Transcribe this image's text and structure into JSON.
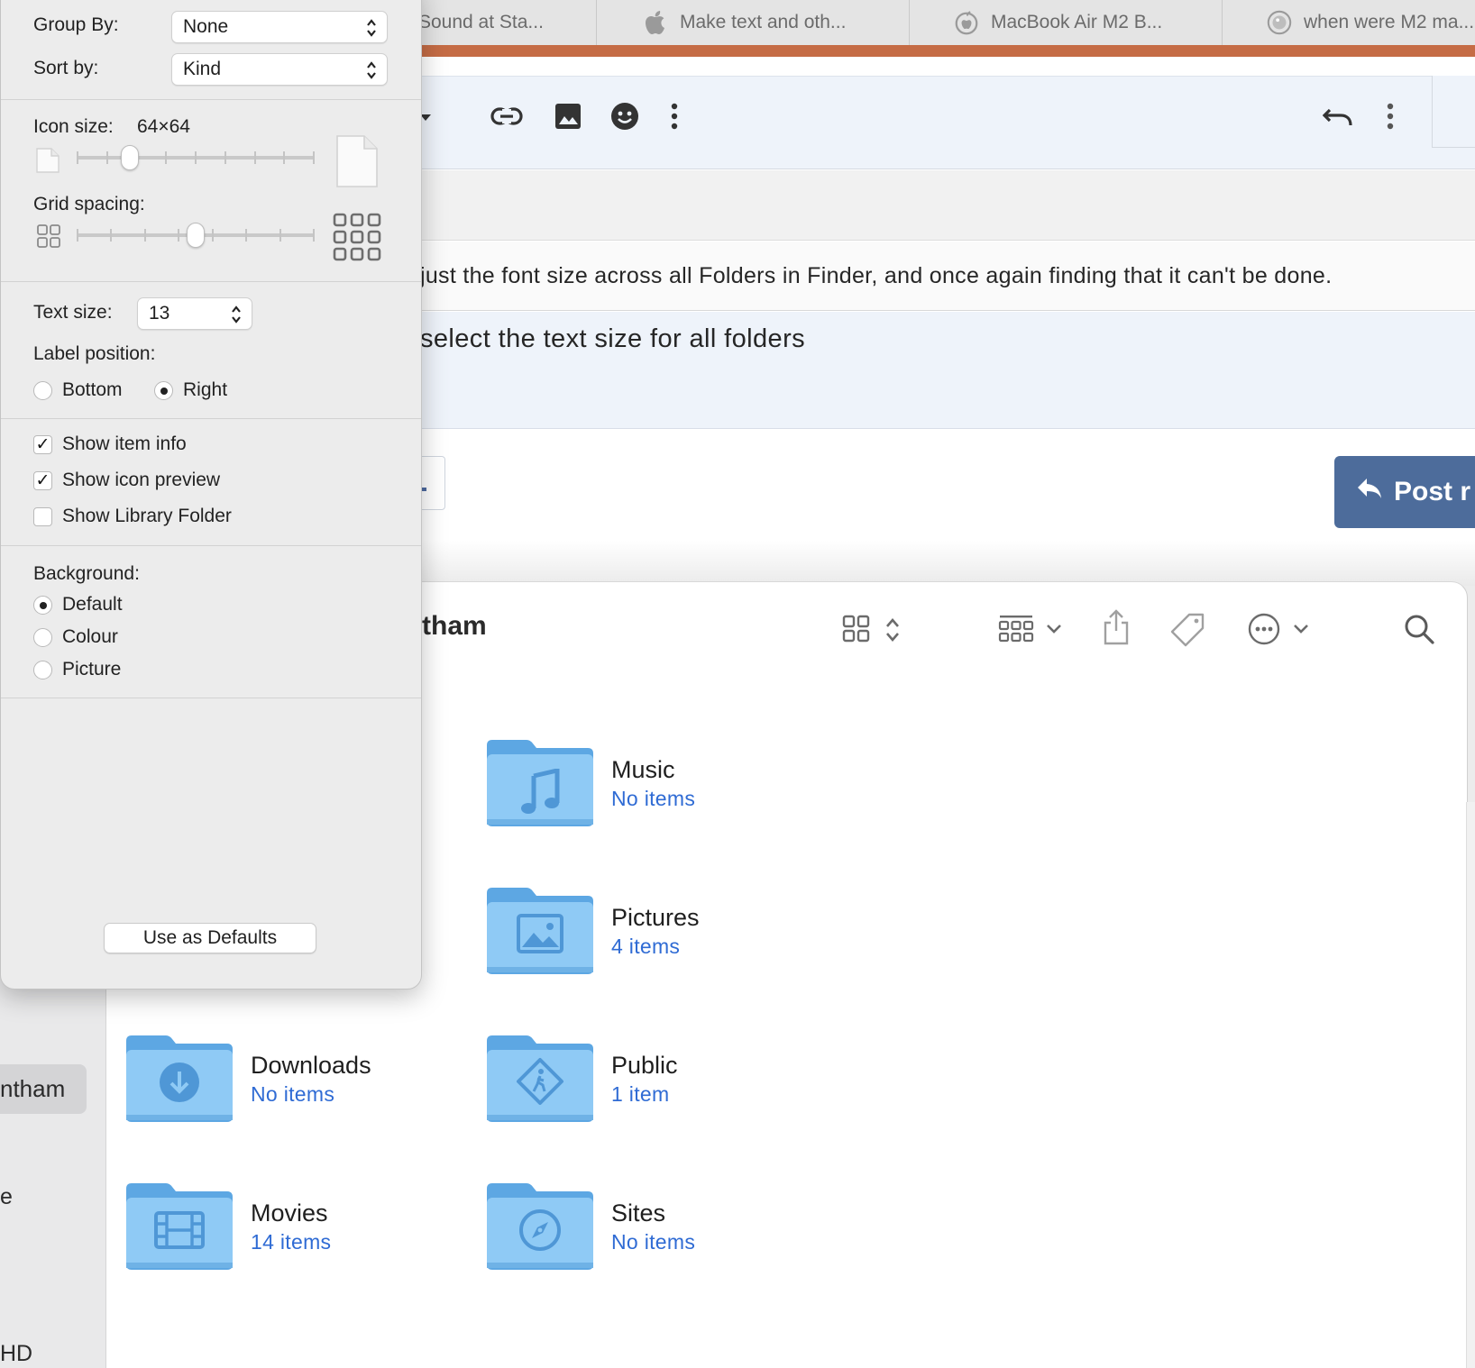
{
  "browser": {
    "tabs": [
      {
        "title": "Sound at Sta...",
        "icon": "page-icon"
      },
      {
        "title": "Make text and oth...",
        "icon": "apple-icon"
      },
      {
        "title": "MacBook Air M2 B...",
        "icon": "apple-community-icon"
      },
      {
        "title": "when were M2 ma...",
        "icon": "search-engine-icon"
      }
    ],
    "quote_text": "just the font size across all Folders in Finder, and once again finding that it can't be done.",
    "reply_text": "select the text size for all folders",
    "post_reply_label": "Post r",
    "accent_color": "#4d6c9b"
  },
  "view_options": {
    "group_by": {
      "label": "Group By:",
      "value": "None"
    },
    "sort_by": {
      "label": "Sort by:",
      "value": "Kind"
    },
    "icon_size": {
      "label": "Icon size:",
      "value": "64×64",
      "level": 0.2
    },
    "grid_spacing": {
      "label": "Grid spacing:",
      "level": 0.5
    },
    "text_size": {
      "label": "Text size:",
      "value": "13"
    },
    "label_position": {
      "label": "Label position:",
      "options": [
        {
          "label": "Bottom",
          "selected": false
        },
        {
          "label": "Right",
          "selected": true
        }
      ]
    },
    "checkboxes": [
      {
        "label": "Show item info",
        "checked": true
      },
      {
        "label": "Show icon preview",
        "checked": true
      },
      {
        "label": "Show Library Folder",
        "checked": false
      }
    ],
    "background": {
      "label": "Background:",
      "options": [
        {
          "label": "Default",
          "selected": true
        },
        {
          "label": "Colour",
          "selected": false
        },
        {
          "label": "Picture",
          "selected": false
        }
      ]
    },
    "use_as_defaults_label": "Use as Defaults"
  },
  "finder": {
    "title": "tham",
    "sidebar": {
      "selected_item": "ntham",
      "item_e": "e",
      "item_hd": "HD"
    },
    "folders": [
      {
        "name": "Music",
        "count": "No items",
        "icon": "music-note-icon"
      },
      {
        "name": "Pictures",
        "count": "4 items",
        "icon": "photo-icon"
      },
      {
        "name": "Downloads",
        "count": "No items",
        "icon": "download-arrow-icon"
      },
      {
        "name": "Public",
        "count": "1 item",
        "icon": "walking-person-icon"
      },
      {
        "name": "Movies",
        "count": "14 items",
        "icon": "film-icon"
      },
      {
        "name": "Sites",
        "count": "No items",
        "icon": "compass-icon"
      }
    ],
    "folder_color": "#8fcaf5",
    "count_color": "#2f6bd4"
  }
}
